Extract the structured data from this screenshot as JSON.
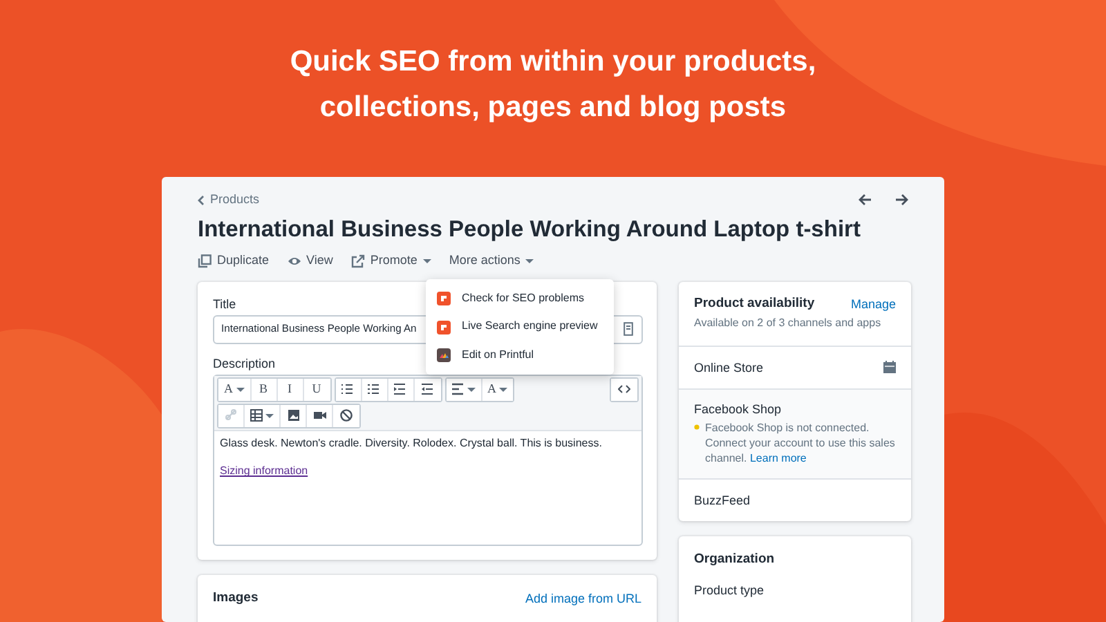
{
  "headline": [
    "Quick SEO from within your products,",
    "collections, pages and blog posts"
  ],
  "breadcrumb": "Products",
  "product_title": "International Business People Working Around Laptop t-shirt",
  "actions": [
    {
      "label": "Duplicate",
      "kind": "duplicate",
      "dropdown": false
    },
    {
      "label": "View",
      "kind": "view",
      "dropdown": false
    },
    {
      "label": "Promote",
      "kind": "promote",
      "dropdown": true
    },
    {
      "label": "More actions",
      "kind": "none",
      "dropdown": true
    }
  ],
  "menu": [
    {
      "label": "Check for SEO problems",
      "kind": "seo"
    },
    {
      "label": "Live Search engine preview",
      "kind": "seo"
    },
    {
      "label": "Edit on Printful",
      "kind": "printful"
    }
  ],
  "title_field": {
    "label": "Title",
    "value": "International Business People Working An"
  },
  "description": {
    "label": "Description",
    "toolbar": [
      [
        {
          "kind": "text",
          "label": "A",
          "dropdown": true
        },
        {
          "kind": "text",
          "label": "B",
          "dropdown": false
        },
        {
          "kind": "text",
          "label": "I",
          "dropdown": false
        },
        {
          "kind": "text",
          "label": "U",
          "dropdown": false
        }
      ],
      [
        {
          "kind": "bullets",
          "dropdown": false
        },
        {
          "kind": "numbers",
          "dropdown": false
        },
        {
          "kind": "indent",
          "dropdown": false
        },
        {
          "kind": "outdent",
          "dropdown": false
        }
      ],
      [
        {
          "kind": "align",
          "dropdown": true
        },
        {
          "kind": "text",
          "label": "A",
          "dropdown": true
        }
      ],
      [
        {
          "kind": "link",
          "dropdown": false
        },
        {
          "kind": "table",
          "dropdown": true
        },
        {
          "kind": "image",
          "dropdown": false
        },
        {
          "kind": "video",
          "dropdown": false
        },
        {
          "kind": "clear",
          "dropdown": false
        }
      ]
    ],
    "body": "Glass desk. Newton's cradle. Diversity. Rolodex. Crystal ball. This is business.",
    "link": "Sizing information"
  },
  "images": {
    "title": "Images",
    "action": "Add image from URL"
  },
  "availability": {
    "title": "Product availability",
    "action": "Manage",
    "subtitle": "Available on 2 of 3 channels and apps",
    "channels": [
      {
        "name": "Online Store",
        "kind": "scheduled"
      },
      {
        "name": "Facebook Shop",
        "kind": "warning",
        "note": "Facebook Shop is not connected. Connect your account to use this sales channel.",
        "link": "Learn more"
      },
      {
        "name": "BuzzFeed",
        "kind": "plain"
      }
    ]
  },
  "organization": {
    "title": "Organization",
    "field_label": "Product type"
  }
}
